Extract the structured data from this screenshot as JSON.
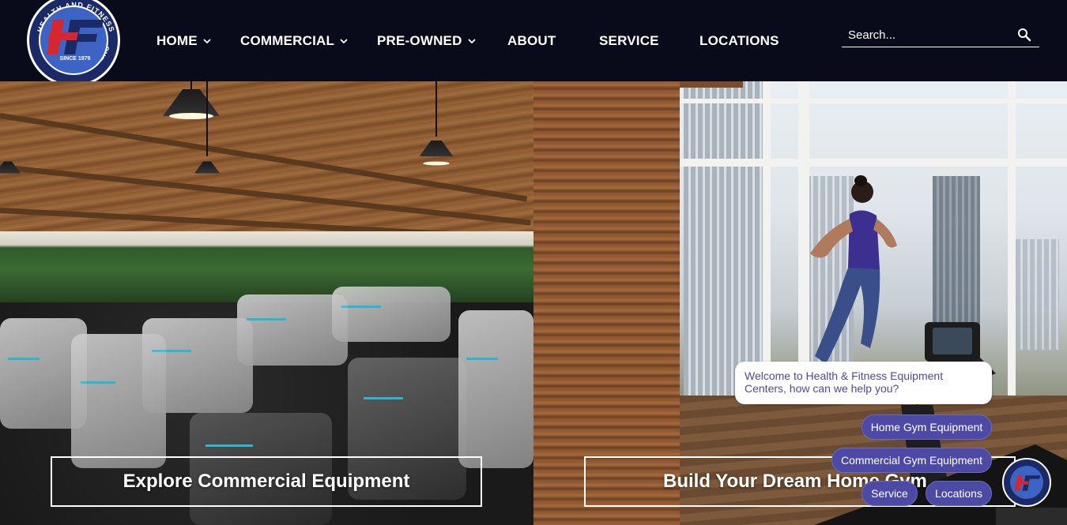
{
  "brand": {
    "logo_arc_top": "HEALTH AND FITNESS",
    "logo_since": "SINCE 1979",
    "logo_arc_bottom": "EQUIPMENT CENTERS",
    "logo_letters": "HF",
    "colors": {
      "navy": "#1b2a66",
      "blue": "#3d63c4",
      "red": "#d8262e",
      "header_bg": "#0a0b1a"
    }
  },
  "nav": {
    "home": "HOME",
    "commercial": "COMMERCIAL",
    "preowned": "PRE-OWNED",
    "about": "ABOUT",
    "service": "SERVICE",
    "locations": "LOCATIONS"
  },
  "search": {
    "placeholder": "Search...",
    "icon": "search-icon"
  },
  "hero": {
    "left_cta": "Explore Commercial Equipment",
    "right_cta": "Build Your Dream Home Gym"
  },
  "chat": {
    "welcome": "Welcome to Health & Fitness Equipment Centers, how can we help you?",
    "options": {
      "home_gym": "Home Gym Equipment",
      "commercial_gym": "Commercial Gym Equipment",
      "service": "Service",
      "locations": "Locations"
    },
    "accent_color": "#4d4aa6"
  }
}
